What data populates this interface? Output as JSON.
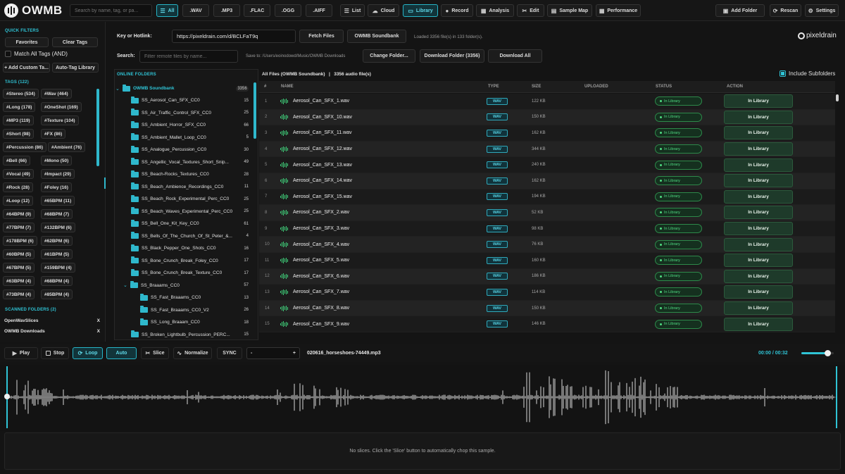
{
  "app": {
    "logo_text": "OWMB"
  },
  "topbar": {
    "search_placeholder": "Search by name, tag, or pa...",
    "filters": [
      {
        "label": "All",
        "active": true,
        "icon": "filter-icon"
      },
      {
        "label": ".WAV",
        "active": false
      },
      {
        "label": ".MP3",
        "active": false
      },
      {
        "label": ".FLAC",
        "active": false
      },
      {
        "label": ".OGG",
        "active": false
      },
      {
        "label": ".AIFF",
        "active": false
      }
    ],
    "views": [
      {
        "label": "List",
        "icon": "list-icon",
        "active": false
      },
      {
        "label": "Cloud",
        "icon": "cloud-icon",
        "active": false
      },
      {
        "label": "Library",
        "icon": "book-icon",
        "active": true
      },
      {
        "label": "Record",
        "icon": "mic-icon",
        "active": false
      },
      {
        "label": "Analysis",
        "icon": "chart-icon",
        "active": false
      },
      {
        "label": "Edit",
        "icon": "scissors-icon",
        "active": false
      },
      {
        "label": "Sample Map",
        "icon": "map-icon",
        "active": false
      },
      {
        "label": "Performance",
        "icon": "grid-icon",
        "active": false
      }
    ],
    "right": [
      {
        "label": "Add Folder",
        "icon": "folder-plus-icon"
      },
      {
        "label": "Rescan",
        "icon": "refresh-icon"
      },
      {
        "label": "Settings",
        "icon": "gear-icon"
      }
    ]
  },
  "sidebar": {
    "quick_filters_title": "QUICK FILTERS",
    "favorites": "Favorites",
    "clear_tags": "Clear Tags",
    "match_all": "Match All Tags (AND)",
    "add_custom": "+ Add Custom Ta...",
    "auto_tag": "Auto-Tag Library",
    "tags_title": "TAGS (122)",
    "tags": [
      [
        "#Stereo (534)",
        "#Wav (464)"
      ],
      [
        "#Long (178)",
        "#OneShot (169)"
      ],
      [
        "#MP3 (119)",
        "#Texture (104)"
      ],
      [
        "#Short (98)",
        "#FX (86)"
      ],
      [
        "#Percussion (86)",
        "#Ambient (76)"
      ],
      [
        "#Bell (66)",
        "#Mono (50)"
      ],
      [
        "#Vocal (49)",
        "#Impact (29)"
      ],
      [
        "#Rock (28)",
        "#Foley (16)"
      ],
      [
        "#Loop (12)",
        "#65BPM (11)"
      ],
      [
        "#64BPM (9)",
        "#68BPM (7)"
      ],
      [
        "#77BPM (7)",
        "#132BPM (6)"
      ],
      [
        "#178BPM (6)",
        "#62BPM (6)"
      ],
      [
        "#60BPM (5)",
        "#61BPM (5)"
      ],
      [
        "#67BPM (5)",
        "#159BPM (4)"
      ],
      [
        "#63BPM (4)",
        "#68BPM (4)"
      ],
      [
        "#73BPM (4)",
        "#85BPM (4)"
      ]
    ],
    "scanned_title": "SCANNED FOLDERS (2)",
    "scanned": [
      "OpenWavSlices",
      "OWMB Downloads"
    ],
    "remove_label": "X"
  },
  "remote": {
    "key_label": "Key or Hotlink:",
    "key_value": "https://pixeldrain.com/d/BCLFaT9q",
    "fetch": "Fetch Files",
    "soundbank": "OWMB Soundbank",
    "loaded_info": "Loaded 3356 file(s) in 133 folder(s).",
    "brand": "pixeldrain",
    "search_label": "Search:",
    "search_placeholder": "Filter remote files by name...",
    "save_to": "Save to: /Users/eoinodowd/Music/OWMB Downloads",
    "change_folder": "Change Folder...",
    "download_folder": "Download Folder (3356)",
    "download_all": "Download All"
  },
  "folders": {
    "header": "ONLINE FOLDERS",
    "root": {
      "name": "OWMB Soundbank",
      "count": "3356"
    },
    "items": [
      {
        "name": "SS_Aerosol_Can_SFX_CC0",
        "count": "15",
        "indent": 1
      },
      {
        "name": "SS_Air_Traffic_Control_SFX_CC0",
        "count": "25",
        "indent": 1
      },
      {
        "name": "SS_Ambient_Horror_SFX_CC0",
        "count": "66",
        "indent": 1
      },
      {
        "name": "SS_Ambient_Mallet_Loop_CC0",
        "count": "5",
        "indent": 1
      },
      {
        "name": "SS_Analogue_Percussion_CC0",
        "count": "30",
        "indent": 1
      },
      {
        "name": "SS_Angellic_Vocal_Textures_Short_Snip...",
        "count": "49",
        "indent": 1
      },
      {
        "name": "SS_Beach-Rocks_Textures_CC0",
        "count": "28",
        "indent": 1
      },
      {
        "name": "SS_Beach_Ambience_Recordings_CC0",
        "count": "11",
        "indent": 1
      },
      {
        "name": "SS_Beach_Rock_Experimental_Perc_CC0",
        "count": "25",
        "indent": 1
      },
      {
        "name": "SS_Beach_Waves_Experimental_Perc_CC0",
        "count": "25",
        "indent": 1
      },
      {
        "name": "SS_Bell_One_Kit_Key_CC0",
        "count": "61",
        "indent": 1
      },
      {
        "name": "SS_Bells_Of_The_Church_Of_St_Peter_&...",
        "count": "4",
        "indent": 1
      },
      {
        "name": "SS_Black_Pepper_One_Shots_CC0",
        "count": "16",
        "indent": 1
      },
      {
        "name": "SS_Bone_Crunch_Break_Foley_CC0",
        "count": "17",
        "indent": 1
      },
      {
        "name": "SS_Bone_Crunch_Break_Texture_CC0",
        "count": "17",
        "indent": 1
      },
      {
        "name": "SS_Braaams_CC0",
        "count": "57",
        "indent": 1,
        "expanded": true
      },
      {
        "name": "SS_Fast_Braaams_CC0",
        "count": "13",
        "indent": 2
      },
      {
        "name": "SS_Fast_Braaams_CC0_V2",
        "count": "26",
        "indent": 2
      },
      {
        "name": "SS_Long_Braaam_CC0",
        "count": "18",
        "indent": 2
      },
      {
        "name": "SS_Broken_Lightbulb_Percussion_PERC...",
        "count": "15",
        "indent": 1
      }
    ]
  },
  "table": {
    "summary": "All Files (OWMB Soundbank)   |   3356 audio file(s)",
    "include_subfolders": "Include Subfolders",
    "columns": [
      "#",
      "NAME",
      "TYPE",
      "SIZE",
      "UPLOADED",
      "STATUS",
      "ACTION"
    ],
    "rows": [
      {
        "num": "1",
        "name": "Aerosol_Can_SFX_1.wav",
        "type": "WAV",
        "size": "122 KB",
        "status": "In Library",
        "action": "In Library"
      },
      {
        "num": "2",
        "name": "Aerosol_Can_SFX_10.wav",
        "type": "WAV",
        "size": "150 KB",
        "status": "In Library",
        "action": "In Library"
      },
      {
        "num": "3",
        "name": "Aerosol_Can_SFX_11.wav",
        "type": "WAV",
        "size": "162 KB",
        "status": "In Library",
        "action": "In Library"
      },
      {
        "num": "4",
        "name": "Aerosol_Can_SFX_12.wav",
        "type": "WAV",
        "size": "344 KB",
        "status": "In Library",
        "action": "In Library"
      },
      {
        "num": "5",
        "name": "Aerosol_Can_SFX_13.wav",
        "type": "WAV",
        "size": "240 KB",
        "status": "In Library",
        "action": "In Library"
      },
      {
        "num": "6",
        "name": "Aerosol_Can_SFX_14.wav",
        "type": "WAV",
        "size": "162 KB",
        "status": "In Library",
        "action": "In Library"
      },
      {
        "num": "7",
        "name": "Aerosol_Can_SFX_15.wav",
        "type": "WAV",
        "size": "194 KB",
        "status": "In Library",
        "action": "In Library"
      },
      {
        "num": "8",
        "name": "Aerosol_Can_SFX_2.wav",
        "type": "WAV",
        "size": "52 KB",
        "status": "In Library",
        "action": "In Library"
      },
      {
        "num": "9",
        "name": "Aerosol_Can_SFX_3.wav",
        "type": "WAV",
        "size": "98 KB",
        "status": "In Library",
        "action": "In Library"
      },
      {
        "num": "10",
        "name": "Aerosol_Can_SFX_4.wav",
        "type": "WAV",
        "size": "76 KB",
        "status": "In Library",
        "action": "In Library"
      },
      {
        "num": "11",
        "name": "Aerosol_Can_SFX_5.wav",
        "type": "WAV",
        "size": "160 KB",
        "status": "In Library",
        "action": "In Library"
      },
      {
        "num": "12",
        "name": "Aerosol_Can_SFX_6.wav",
        "type": "WAV",
        "size": "186 KB",
        "status": "In Library",
        "action": "In Library"
      },
      {
        "num": "13",
        "name": "Aerosol_Can_SFX_7.wav",
        "type": "WAV",
        "size": "114 KB",
        "status": "In Library",
        "action": "In Library"
      },
      {
        "num": "14",
        "name": "Aerosol_Can_SFX_8.wav",
        "type": "WAV",
        "size": "150 KB",
        "status": "In Library",
        "action": "In Library"
      },
      {
        "num": "15",
        "name": "Aerosol_Can_SFX_9.wav",
        "type": "WAV",
        "size": "146 KB",
        "status": "In Library",
        "action": "In Library"
      }
    ]
  },
  "transport": {
    "play": "Play",
    "stop": "Stop",
    "loop": "Loop",
    "auto": "Auto",
    "slice": "Slice",
    "normalize": "Normalize",
    "sync": "SYNC",
    "minus": "-",
    "plus": "+",
    "filename": "020616_horseshoes-74449.mp3",
    "time": "00:00 / 00:32",
    "volume": 0.8
  },
  "slices_message": "No slices. Click the 'Slice' button to automatically chop this sample.",
  "colors": {
    "accent": "#2fc4d6",
    "green": "#4fdc82",
    "bg": "#141414"
  }
}
